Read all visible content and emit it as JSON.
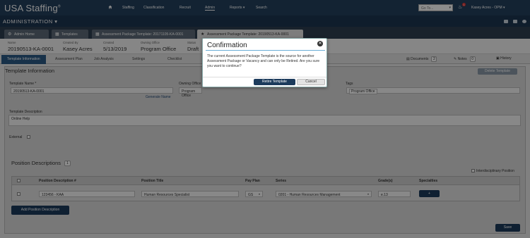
{
  "app": {
    "logo": "USA Staffing",
    "logo_mark": "®"
  },
  "nav": {
    "items": [
      "Staffing",
      "Classification",
      "Recruit",
      "Admin",
      "Reports ▾",
      "Search"
    ],
    "goto_placeholder": "Go To...",
    "notification_count": "1",
    "user": "Kasey Acres - OPM ▾"
  },
  "section": {
    "title": "ADMINISTRATION ▾"
  },
  "tabs": [
    {
      "icon": "⚙",
      "label": "Admin Home"
    },
    {
      "icon": "▦",
      "label": "Templates"
    },
    {
      "icon": "▦",
      "label": "Assessment Package Template: 20171105-KA-0001"
    },
    {
      "icon": "★",
      "label": "Assessment Package Template: 20190513-KA-0001"
    }
  ],
  "info": {
    "name_label": "Name",
    "name": "20190513-KA-0001",
    "created_by_label": "Created By",
    "created_by": "Kasey Acres",
    "created_label": "Created",
    "created": "5/13/2019",
    "owning_office_label": "Owning Office",
    "owning_office": "Program Office",
    "status_label": "Status",
    "status": "Draft"
  },
  "subtabs": {
    "items": [
      "Template Information",
      "Assessment Plan",
      "Job Analysis",
      "Settings",
      "Checklist"
    ],
    "documents_label": "Documents",
    "documents_count": "2",
    "notes_label": "Notes",
    "notes_count": "0",
    "history_label": "History"
  },
  "form": {
    "panel_title": "Template Information",
    "delete_button": "Delete Template",
    "template_name_label": "Template Name *",
    "template_name_value": "20190513-KA-0001",
    "generate_name_link": "Generate Name",
    "owning_office_label": "Owning Office *",
    "owning_office_value": "Program Office",
    "tags_label": "Tags",
    "tags_value": "Program Office",
    "description_label": "Template Description",
    "description_value": "Online Help",
    "external_label": "External"
  },
  "positions": {
    "title": "Position Descriptions",
    "count": "1",
    "interdisciplinary_label": "Interdisciplinary Position",
    "headers": [
      "Position Description #",
      "Position Title",
      "Pay Plan",
      "Series",
      "Grade(s)",
      "Specialties"
    ],
    "row": {
      "pd_number": "123456 - KAA",
      "title": "Human Resources Specialist",
      "pay_plan": "GS",
      "series": "0201 - Human Resources Management",
      "grade": "e.13",
      "specialties_button": "+"
    },
    "add_button": "Add Position Description"
  },
  "save_button": "Save",
  "modal": {
    "title": "Confirmation",
    "close": "✕",
    "body": "The current Assessment Package Template is the source for another Assessment Package or Vacancy and can only be Retired. Are you sure you want to continue?",
    "confirm": "Retire Template",
    "cancel": "Cancel"
  }
}
